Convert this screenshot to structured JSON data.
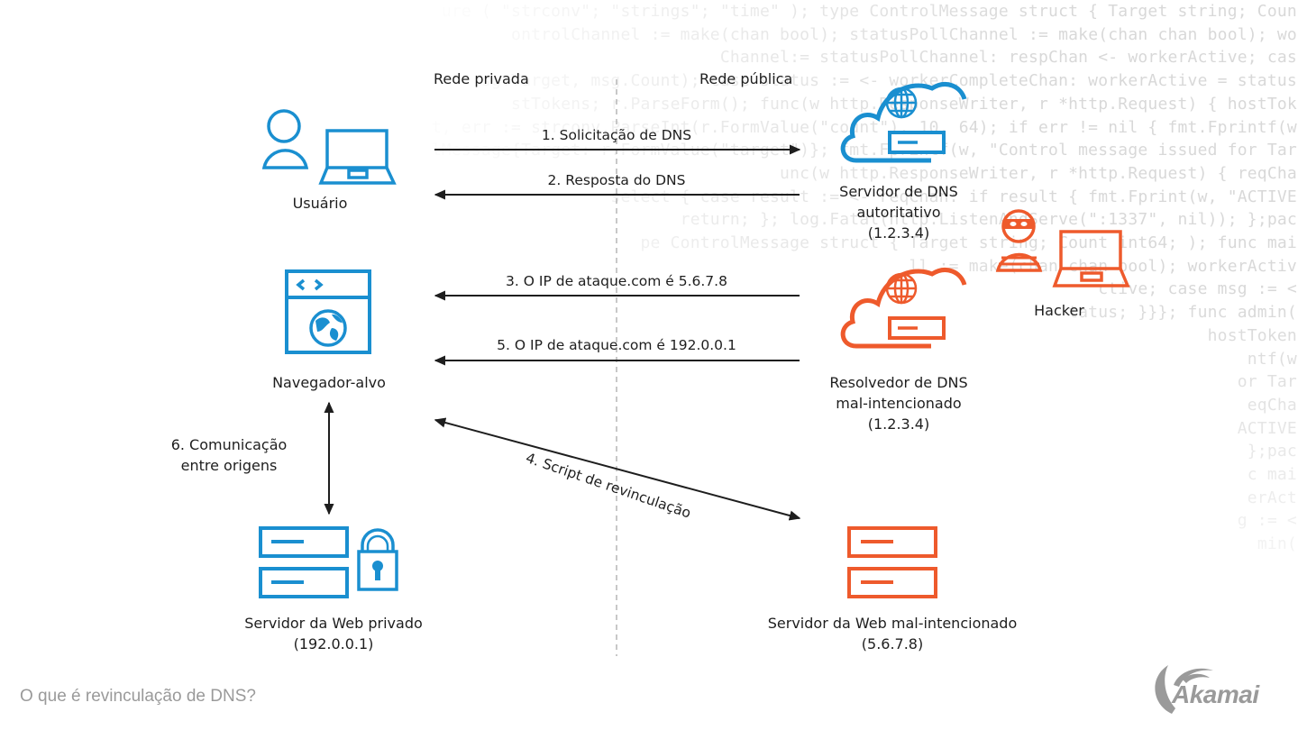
{
  "colors": {
    "private_blue": "#1a8fd0",
    "malicious_orange": "#ee5a2c",
    "arrow": "#1e1e1e",
    "divider": "#b5b5b5",
    "footer_text": "#9a9a9a"
  },
  "zones": {
    "private": "Rede privada",
    "public": "Rede pública"
  },
  "nodes": {
    "user": {
      "label": "Usuário",
      "icons": [
        "person-icon",
        "laptop-icon"
      ]
    },
    "auth_dns": {
      "line1": "Servidor de DNS",
      "line2": "autoritativo",
      "ip": "(1.2.3.4)",
      "icon": "cloud-dns-server-icon"
    },
    "hacker": {
      "label": "Hacker",
      "icons": [
        "masked-hacker-icon",
        "laptop-icon"
      ]
    },
    "browser": {
      "label": "Navegador-alvo",
      "icon": "browser-globe-icon"
    },
    "malicious_dns": {
      "line1": "Resolvedor de DNS",
      "line2": "mal-intencionado",
      "ip": "(1.2.3.4)",
      "icon": "cloud-dns-server-icon"
    },
    "private_web": {
      "line1": "Servidor da Web privado",
      "ip": "(192.0.0.1)",
      "icons": [
        "server-stack-icon",
        "padlock-icon"
      ]
    },
    "malicious_web": {
      "line1": "Servidor da Web mal-intencionado",
      "ip": "(5.6.7.8)",
      "icon": "server-stack-icon"
    }
  },
  "arrows": {
    "a1": "1. Solicitação de DNS",
    "a2": "2. Resposta do DNS",
    "a3": "3. O IP de ataque.com é 5.6.7.8",
    "a4": "4. Script de revinculação",
    "a5": "5. O IP de ataque.com é 192.0.0.1",
    "a6_line1": "6. Comunicação",
    "a6_line2": "entre origens"
  },
  "background_code": [
    "ure ( \"strconv\"; \"strings\"; \"time\" ); type ControlMessage struct { Target string; Count",
    "ontrolChannel := make(chan bool); statusPollChannel := make(chan chan bool); wor",
    "Channel:= statusPollChannel: respChan <- workerActive; case",
    "sg.Target, msg.Count); case status := <- workerCompleteChan: workerActive = status;",
    "stTokens; r.ParseForm(); func(w http.ResponseWriter, r *http.Request) { hostToke",
    "count, err := strconv.ParseInt(r.FormValue(\"count\"), 10, 64); if err != nil { fmt.Fprintf(w,",
    "msg := ControlMessage{Target: r.FormValue(\"target\")}; fmt.Fprintf(w, \"Control message issued for Targ",
    "unc(w http.ResponseWriter, r *http.Request) { reqChan",
    "select { case result := <- reqChan: if result { fmt.Fprint(w, \"ACTIVE\"",
    "return; }; log.Fatal(http.ListenAndServe(\":1337\", nil)); };pack",
    "pe ControlMessage struct { Target string; Count int64; ); func main",
    "ll := make(chan chan bool); workerActive",
    "ctive; case msg := <-",
    "tatus; }}}; func admin(c",
    "hostTokens",
    "ntf(w,",
    "or Targ",
    "eqChan",
    "ACTIVE\"",
    "};pack",
    "c main",
    "erActi",
    "g := <-",
    "min(c"
  ],
  "footer": {
    "title": "O que é revinculação de DNS?",
    "brand": "Akamai"
  }
}
